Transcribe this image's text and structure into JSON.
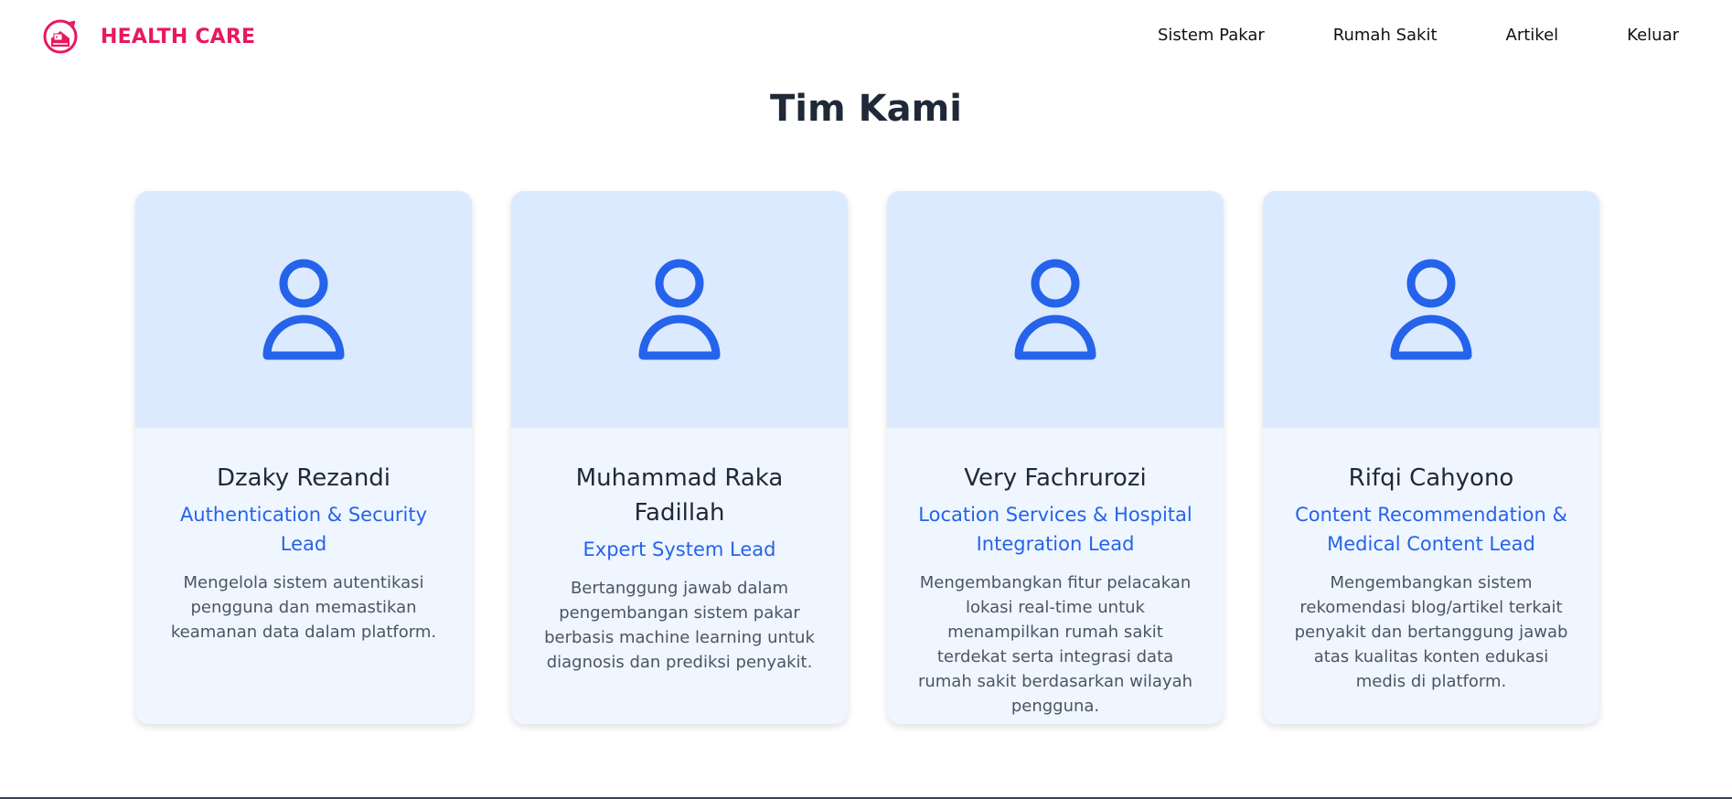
{
  "brand": {
    "name": "HEALTH CARE",
    "logo_icon": "health-care-logo-icon",
    "color": "#e8185f"
  },
  "nav": {
    "items": [
      {
        "label": "Sistem Pakar"
      },
      {
        "label": "Rumah Sakit"
      },
      {
        "label": "Artikel"
      },
      {
        "label": "Keluar"
      }
    ]
  },
  "section": {
    "title": "Tim Kami"
  },
  "team": [
    {
      "name": "Dzaky Rezandi",
      "role": "Authentication & Security Lead",
      "description": "Mengelola sistem autentikasi pengguna dan memastikan keamanan data dalam platform.",
      "icon": "user-icon"
    },
    {
      "name": "Muhammad Raka Fadillah",
      "role": "Expert System Lead",
      "description": "Bertanggung jawab dalam pengembangan sistem pakar berbasis machine learning untuk diagnosis dan prediksi penyakit.",
      "icon": "user-icon"
    },
    {
      "name": "Very Fachrurozi",
      "role": "Location Services & Hospital Integration Lead",
      "description": "Mengembangkan fitur pelacakan lokasi real-time untuk menampilkan rumah sakit terdekat serta integrasi data rumah sakit berdasarkan wilayah pengguna.",
      "icon": "user-icon"
    },
    {
      "name": "Rifqi Cahyono",
      "role": "Content Recommendation & Medical Content Lead",
      "description": "Mengembangkan sistem rekomendasi blog/artikel terkait penyakit dan bertanggung jawab atas kualitas konten edukasi medis di platform.",
      "icon": "user-icon"
    }
  ],
  "colors": {
    "accent": "#2563eb",
    "card_top": "#dbeafe",
    "card_bottom": "#eff6ff"
  }
}
